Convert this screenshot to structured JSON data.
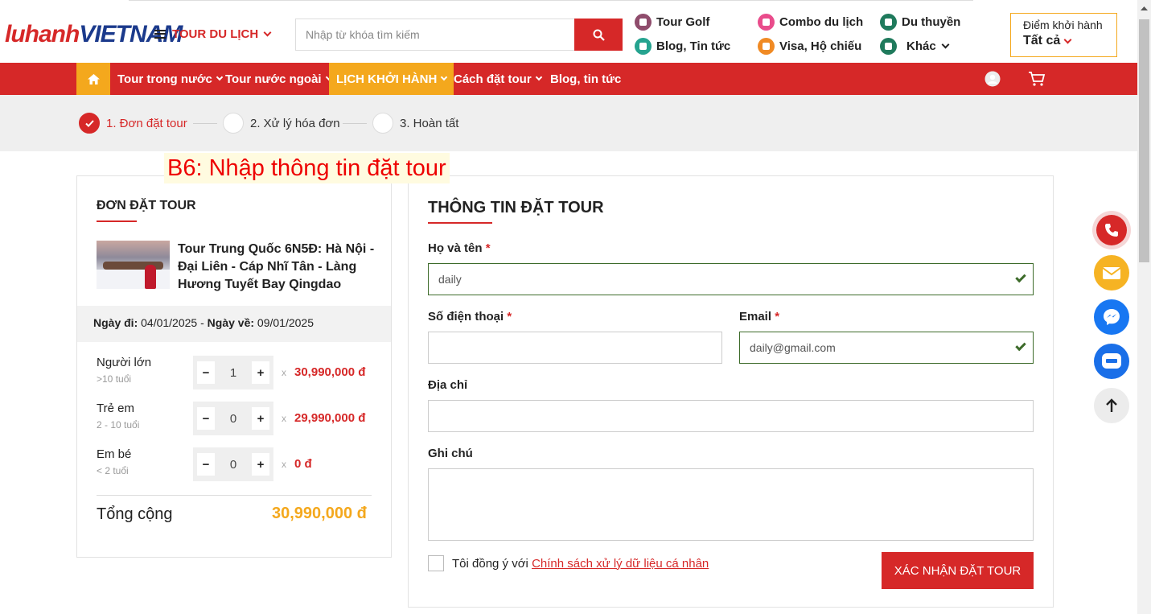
{
  "header": {
    "logo": {
      "part1": "luhanh",
      "part2": "VIETNAM"
    },
    "tour_menu": "TOUR DU LỊCH",
    "search_placeholder": "Nhập từ khóa tìm kiếm",
    "quick_links": [
      {
        "label": "Tour Golf",
        "icon": "golf-icon",
        "color": "#8f4c6c"
      },
      {
        "label": "Combo du lịch",
        "icon": "combo-icon",
        "color": "#e94c8b"
      },
      {
        "label": "Du thuyền",
        "icon": "ship-icon",
        "color": "#1f7a5c"
      },
      {
        "label": "Blog, Tin tức",
        "icon": "blog-icon",
        "color": "#25a38f"
      },
      {
        "label": "Visa, Hộ chiếu",
        "icon": "visa-icon",
        "color": "#f08a24"
      },
      {
        "label": "Khác",
        "icon": "globe-icon",
        "color": "#1f7a5c"
      }
    ],
    "departure": {
      "label": "Điểm khởi hành",
      "value": "Tất cả"
    }
  },
  "nav": {
    "items": [
      "Tour trong nước",
      "Tour nước ngoài",
      "LỊCH KHỞI HÀNH",
      "Cách đặt tour",
      "Blog, tin tức"
    ]
  },
  "steps": [
    "1. Đơn đặt tour",
    "2. Xử lý hóa đơn",
    "3. Hoàn tất"
  ],
  "note": "B6: Nhập thông tin đặt tour",
  "order": {
    "title": "ĐƠN ĐẶT TOUR",
    "tour_name": "Tour Trung Quốc 6N5Đ: Hà Nội - Đại Liên - Cáp Nhĩ Tân - Làng Hương Tuyết Bay Qingdao",
    "depart_label": "Ngày đi:",
    "depart_date": "04/01/2025",
    "return_label": "Ngày về:",
    "return_date": "09/01/2025",
    "passengers": [
      {
        "label": "Người lớn",
        "sub": ">10 tuổi",
        "count": "1",
        "price": "30,990,000 đ"
      },
      {
        "label": "Trẻ em",
        "sub": "2 - 10 tuổi",
        "count": "0",
        "price": "29,990,000 đ"
      },
      {
        "label": "Em bé",
        "sub": "< 2 tuổi",
        "count": "0",
        "price": "0 đ"
      }
    ],
    "minus": "−",
    "plus": "+",
    "times": "x",
    "total_label": "Tổng cộng",
    "total_value": "30,990,000 đ"
  },
  "form": {
    "title": "THÔNG TIN ĐẶT TOUR",
    "name_label": "Họ và tên",
    "name_value": "daily",
    "phone_label": "Số điện thoại",
    "phone_value": "",
    "email_label": "Email",
    "email_value": "daily@gmail.com",
    "address_label": "Địa chỉ",
    "note_label": "Ghi chú",
    "required": "*",
    "agree_text": "Tôi đồng ý với",
    "agree_link": "Chính sách xử lý dữ liệu cá nhân",
    "submit": "XÁC NHẬN ĐẶT TOUR"
  },
  "colors": {
    "brand_red": "#d62828",
    "accent_orange": "#f4a81d",
    "valid_green": "#3d6b2a"
  }
}
